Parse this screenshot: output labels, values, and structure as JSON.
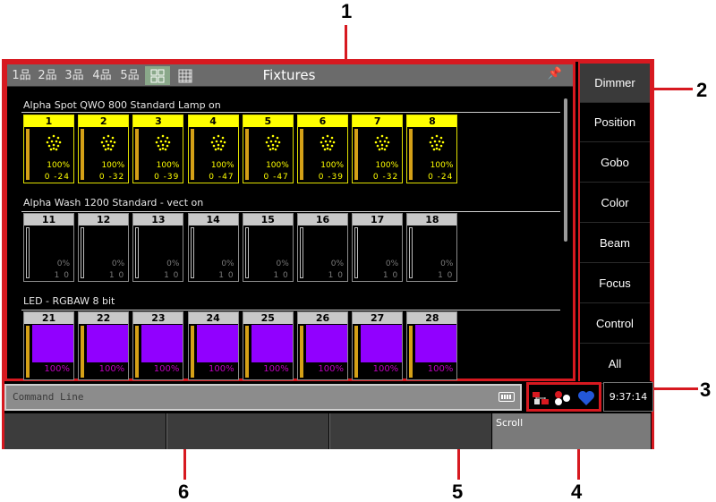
{
  "window": {
    "title": "Fixtures",
    "view_buttons": [
      "1品",
      "2品",
      "3品",
      "4品",
      "5品"
    ]
  },
  "groups": [
    {
      "label": "Alpha Spot QWO 800 Standard Lamp on",
      "type": "spot",
      "fixtures": [
        {
          "id": "1",
          "dimmer": "100%",
          "pantilt": "0 -24"
        },
        {
          "id": "2",
          "dimmer": "100%",
          "pantilt": "0 -32"
        },
        {
          "id": "3",
          "dimmer": "100%",
          "pantilt": "0 -39"
        },
        {
          "id": "4",
          "dimmer": "100%",
          "pantilt": "0 -47"
        },
        {
          "id": "5",
          "dimmer": "100%",
          "pantilt": "0 -47"
        },
        {
          "id": "6",
          "dimmer": "100%",
          "pantilt": "0 -39"
        },
        {
          "id": "7",
          "dimmer": "100%",
          "pantilt": "0 -32"
        },
        {
          "id": "8",
          "dimmer": "100%",
          "pantilt": "0 -24"
        }
      ]
    },
    {
      "label": "Alpha Wash 1200 Standard - vect on",
      "type": "wash",
      "fixtures": [
        {
          "id": "11",
          "dimmer": "0%",
          "pantilt": "1 0"
        },
        {
          "id": "12",
          "dimmer": "0%",
          "pantilt": "1 0"
        },
        {
          "id": "13",
          "dimmer": "0%",
          "pantilt": "1 0"
        },
        {
          "id": "14",
          "dimmer": "0%",
          "pantilt": "1 0"
        },
        {
          "id": "15",
          "dimmer": "0%",
          "pantilt": "1 0"
        },
        {
          "id": "16",
          "dimmer": "0%",
          "pantilt": "1 0"
        },
        {
          "id": "17",
          "dimmer": "0%",
          "pantilt": "1 0"
        },
        {
          "id": "18",
          "dimmer": "0%",
          "pantilt": "1 0"
        }
      ]
    },
    {
      "label": "LED - RGBAW 8 bit",
      "type": "led",
      "fixtures": [
        {
          "id": "21",
          "dimmer": "100%"
        },
        {
          "id": "22",
          "dimmer": "100%"
        },
        {
          "id": "23",
          "dimmer": "100%"
        },
        {
          "id": "24",
          "dimmer": "100%"
        },
        {
          "id": "25",
          "dimmer": "100%"
        },
        {
          "id": "26",
          "dimmer": "100%"
        },
        {
          "id": "27",
          "dimmer": "100%"
        },
        {
          "id": "28",
          "dimmer": "100%"
        }
      ]
    }
  ],
  "sidebar": {
    "items": [
      "Dimmer",
      "Position",
      "Gobo",
      "Color",
      "Beam",
      "Focus",
      "Control",
      "All"
    ],
    "active": "Dimmer"
  },
  "command_line": {
    "placeholder": "Command Line"
  },
  "clock": "9:37:14",
  "encoders": {
    "scroll_label": "Scroll"
  },
  "callouts": [
    "1",
    "2",
    "3",
    "4",
    "5",
    "6"
  ],
  "colors": {
    "accent_red": "#d71920",
    "spot_yellow": "#ffff00",
    "led_purple": "#9100ff"
  }
}
